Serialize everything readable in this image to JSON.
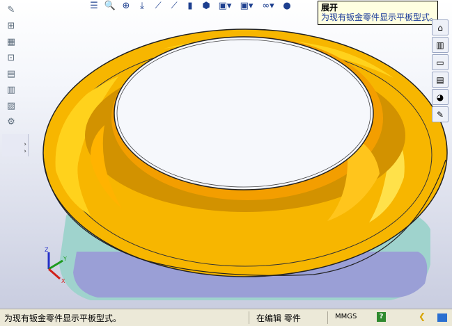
{
  "tooltip": {
    "title": "展开",
    "description": "为现有钣金零件显示平板型式。"
  },
  "status_bar": {
    "message": "为现有钣金零件显示平板型式。",
    "mode": "在编辑 零件",
    "units": "MMGS",
    "help_icon": "help-icon"
  },
  "heads_up_toolbar": {
    "icons": [
      "list-icon",
      "zoom-to-fit-icon",
      "zoom-area-icon",
      "previous-view-icon",
      "section-view-icon",
      "dynamic-annotation-icon",
      "view-orientation-icon",
      "display-style-icon",
      "hide-show-items-icon",
      "edit-appearance-icon",
      "apply-scene-icon",
      "view-settings-icon"
    ]
  },
  "left_toolbar": {
    "icons": [
      "sketch-icon",
      "smart-dimension-icon",
      "sheet-metal-icon",
      "insert-bends-icon",
      "flatten-icon",
      "no-bends-icon",
      "rip-icon",
      "sheet-metal-tools-icon"
    ]
  },
  "task_pane": {
    "icons": [
      "home-icon",
      "design-library-icon",
      "file-explorer-icon",
      "view-palette-icon",
      "appearances-icon",
      "custom-properties-icon"
    ]
  },
  "triad": {
    "x_label": "X",
    "y_label": "Y",
    "z_label": "Z"
  },
  "colors": {
    "part_primary": "#f6b800",
    "part_inner": "#c98d00",
    "part_highlight": "#ffe14a",
    "shadow_teal": "#9fd3cd",
    "shadow_blue": "#9a9fd6",
    "tooltip_bg": "#ffffe1"
  }
}
